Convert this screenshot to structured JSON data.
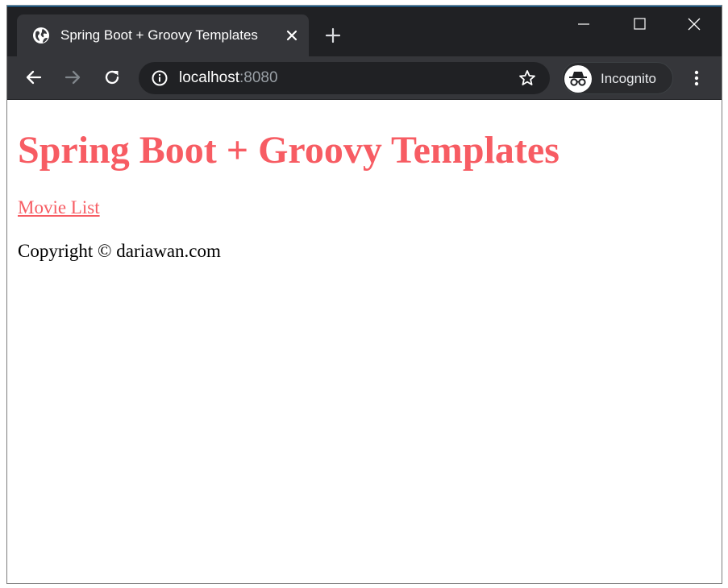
{
  "browser": {
    "tab": {
      "title": "Spring Boot + Groovy Templates",
      "favicon": "globe-icon"
    },
    "omnibox": {
      "host": "localhost",
      "port": ":8080"
    },
    "profile": {
      "label": "Incognito",
      "icon": "incognito-icon"
    },
    "colors": {
      "tabstrip": "#202124",
      "toolbar": "#35363a",
      "omnibox": "#202124"
    }
  },
  "page": {
    "title": "Spring Boot + Groovy Templates",
    "link_label": "Movie List",
    "copyright": "Copyright © dariawan.com",
    "colors": {
      "accent": "#f75c63",
      "text": "#000000"
    }
  }
}
